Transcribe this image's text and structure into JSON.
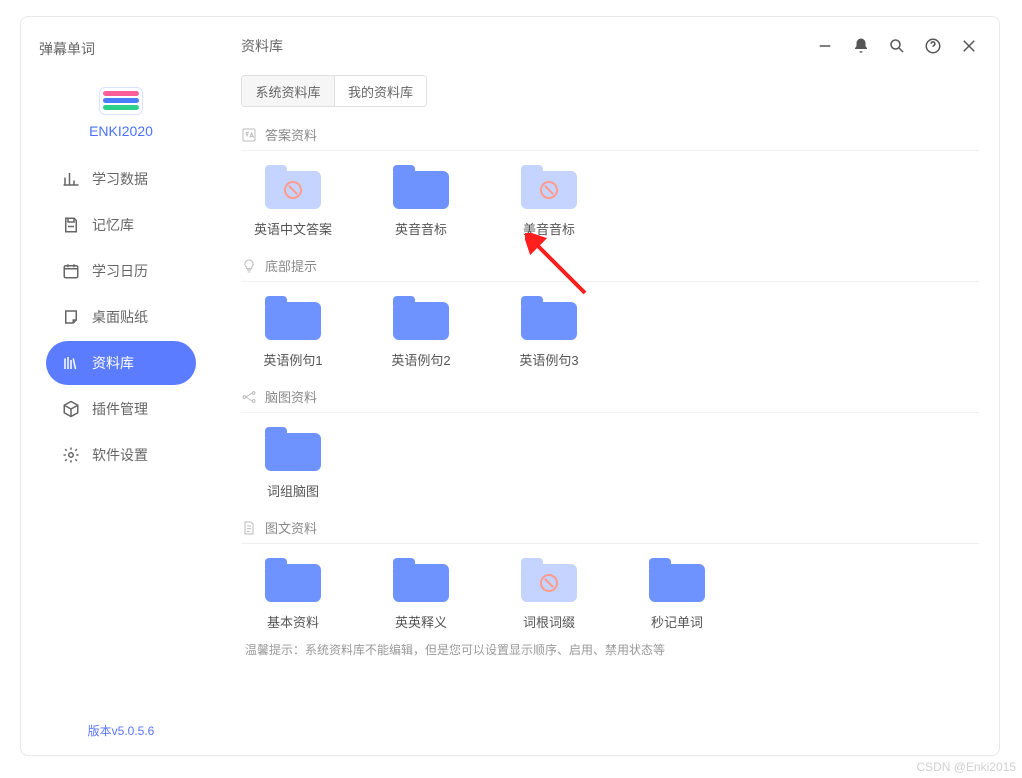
{
  "app": {
    "title": "弹幕单词",
    "brand": "ENKI2020",
    "version": "版本v5.0.5.6"
  },
  "nav": {
    "items": [
      {
        "label": "学习数据"
      },
      {
        "label": "记忆库"
      },
      {
        "label": "学习日历"
      },
      {
        "label": "桌面贴纸"
      },
      {
        "label": "资料库"
      },
      {
        "label": "插件管理"
      },
      {
        "label": "软件设置"
      }
    ],
    "active_index": 4
  },
  "main": {
    "title": "资料库",
    "tabs": [
      {
        "label": "系统资料库",
        "active": true
      },
      {
        "label": "我的资料库",
        "active": false
      }
    ]
  },
  "sections": [
    {
      "id": "answers",
      "title": "答案资料",
      "icon": "translate-icon",
      "folders": [
        {
          "label": "英语中文答案",
          "variant": "light",
          "forbidden": true
        },
        {
          "label": "英音音标",
          "variant": "blue",
          "forbidden": false
        },
        {
          "label": "美音音标",
          "variant": "light",
          "forbidden": true
        }
      ]
    },
    {
      "id": "hints",
      "title": "底部提示",
      "icon": "lightbulb-icon",
      "folders": [
        {
          "label": "英语例句1",
          "variant": "blue",
          "forbidden": false
        },
        {
          "label": "英语例句2",
          "variant": "blue",
          "forbidden": false
        },
        {
          "label": "英语例句3",
          "variant": "blue",
          "forbidden": false
        }
      ]
    },
    {
      "id": "mindmap",
      "title": "脑图资料",
      "icon": "mindmap-icon",
      "folders": [
        {
          "label": "词组脑图",
          "variant": "blue",
          "forbidden": false
        }
      ]
    },
    {
      "id": "docimg",
      "title": "图文资料",
      "icon": "document-icon",
      "folders": [
        {
          "label": "基本资料",
          "variant": "blue",
          "forbidden": false
        },
        {
          "label": "英英释义",
          "variant": "blue",
          "forbidden": false
        },
        {
          "label": "词根词缀",
          "variant": "light",
          "forbidden": true
        },
        {
          "label": "秒记单词",
          "variant": "blue",
          "forbidden": false
        }
      ]
    }
  ],
  "hint": "温馨提示：系统资料库不能编辑，但是您可以设置显示顺序、启用、禁用状态等",
  "watermark": "CSDN @Enki2015"
}
